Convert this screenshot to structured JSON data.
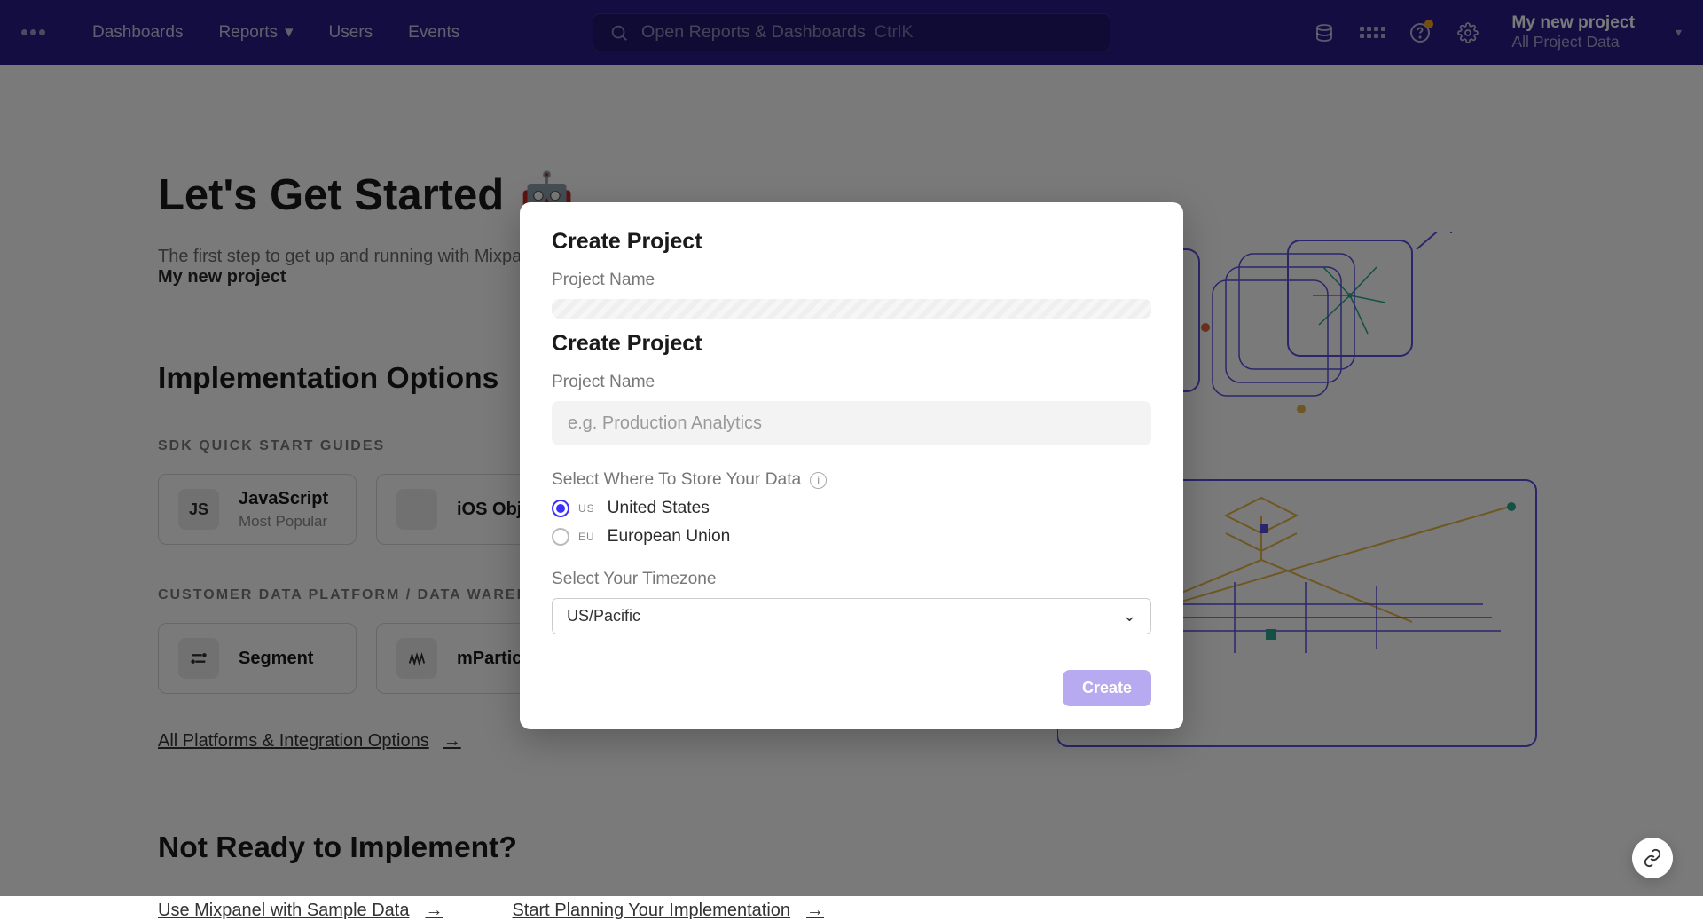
{
  "nav": {
    "items": [
      "Dashboards",
      "Reports",
      "Users",
      "Events"
    ],
    "search_placeholder": "Open Reports & Dashboards",
    "search_kbd": "CtrlK",
    "project_title": "My new project",
    "project_sub": "All Project Data"
  },
  "page": {
    "title": "Let's Get Started",
    "subtitle_prefix": "The first step to get up and running with Mixpa",
    "subtitle_bold": "My new project",
    "impl_heading": "Implementation Options",
    "sdk_label": "SDK QUICK START GUIDES",
    "sdk_cards": [
      {
        "badge": "JS",
        "title": "JavaScript",
        "sub": "Most Popular"
      },
      {
        "badge": "",
        "title": "iOS Obj-C",
        "sub": ""
      }
    ],
    "cdp_label": "CUSTOMER DATA PLATFORM / DATA WAREHOU",
    "cdp_cards": [
      {
        "title": "Segment"
      },
      {
        "title": "mParticle"
      }
    ],
    "all_platforms": "All Platforms & Integration Options",
    "not_ready": "Not Ready to Implement?",
    "links": [
      "Use Mixpanel with Sample Data",
      "Start Planning Your Implementation"
    ]
  },
  "modal": {
    "title": "Create Project",
    "name_label": "Project Name",
    "name_placeholder": "e.g. Production Analytics",
    "store_label": "Select Where To Store Your Data",
    "regions": [
      {
        "code": "US",
        "name": "United States",
        "selected": true
      },
      {
        "code": "EU",
        "name": "European Union",
        "selected": false
      }
    ],
    "tz_label": "Select Your Timezone",
    "tz_value": "US/Pacific",
    "create": "Create"
  }
}
